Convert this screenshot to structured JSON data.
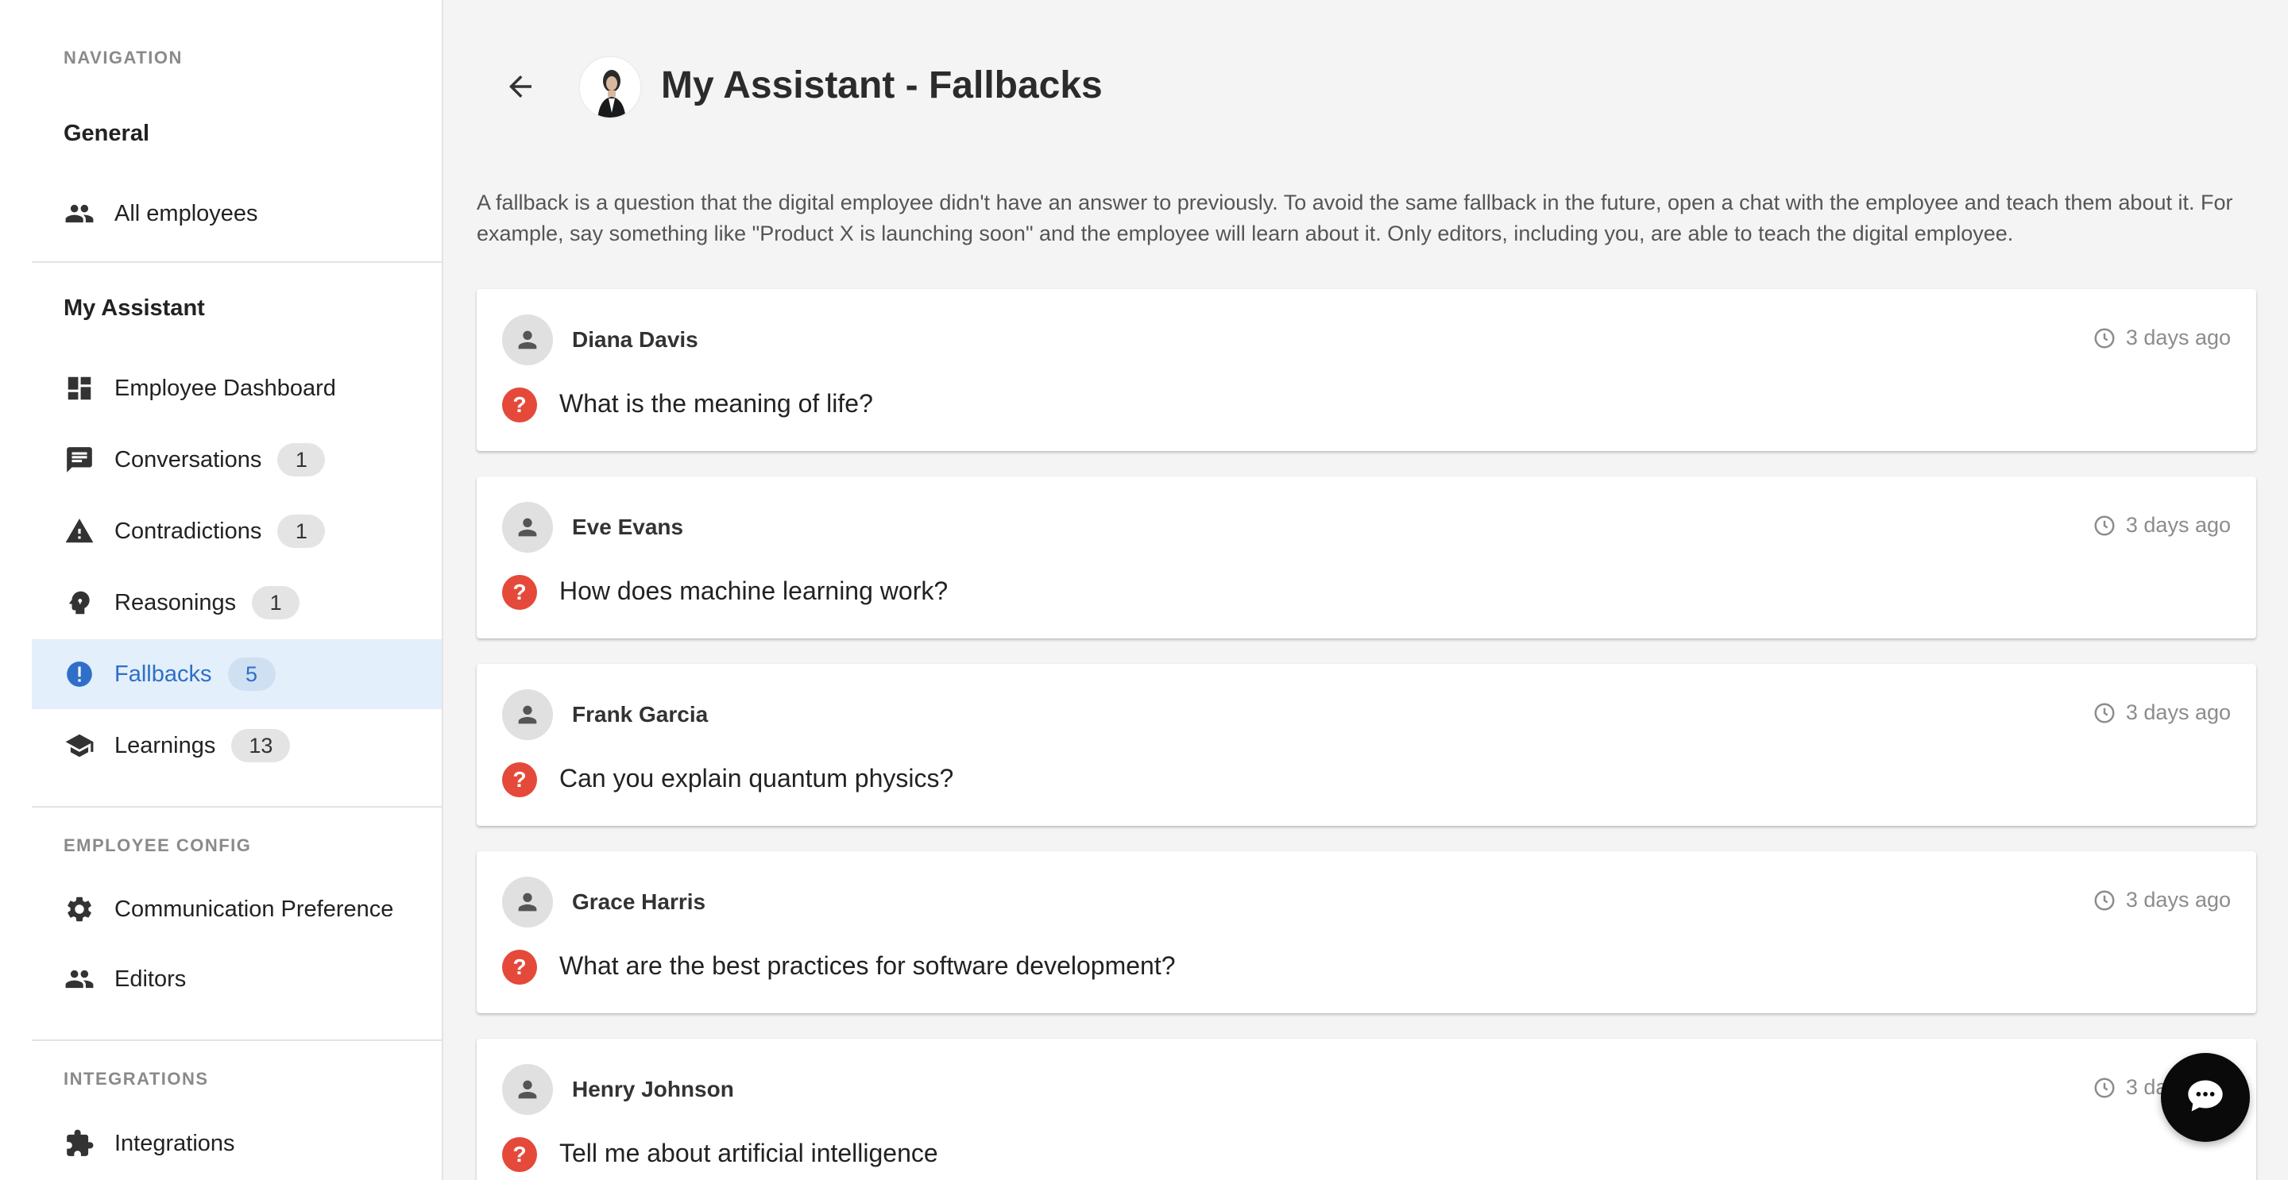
{
  "sidebar": {
    "navigation_heading": "NAVIGATION",
    "general": {
      "title": "General",
      "items": [
        {
          "label": "All employees",
          "icon": "people-icon"
        }
      ]
    },
    "assistant": {
      "title": "My Assistant",
      "items": [
        {
          "label": "Employee Dashboard",
          "icon": "dashboard-icon",
          "badge": ""
        },
        {
          "label": "Conversations",
          "icon": "chat-icon",
          "badge": "1"
        },
        {
          "label": "Contradictions",
          "icon": "warning-icon",
          "badge": "1"
        },
        {
          "label": "Reasonings",
          "icon": "brain-icon",
          "badge": "1"
        },
        {
          "label": "Fallbacks",
          "icon": "alert-circle-icon",
          "badge": "5",
          "active": true
        },
        {
          "label": "Learnings",
          "icon": "graduation-cap-icon",
          "badge": "13"
        }
      ]
    },
    "employee_config": {
      "heading": "EMPLOYEE CONFIG",
      "items": [
        {
          "label": "Communication Preference",
          "icon": "gear-icon"
        },
        {
          "label": "Editors",
          "icon": "people-icon"
        }
      ]
    },
    "integrations": {
      "heading": "INTEGRATIONS",
      "items": [
        {
          "label": "Integrations",
          "icon": "puzzle-icon"
        }
      ]
    }
  },
  "header": {
    "title": "My Assistant - Fallbacks",
    "back_icon": "arrow-left-icon"
  },
  "description": "A fallback is a question that the digital employee didn't have an answer to previously. To avoid the same fallback in the future, open a chat with the employee and teach them about it. For example, say something like \"Product X is launching soon\" and the employee will learn about it. Only editors, including you, are able to teach the digital employee.",
  "fallbacks": [
    {
      "name": "Diana Davis",
      "time": "3 days ago",
      "question": "What is the meaning of life?"
    },
    {
      "name": "Eve Evans",
      "time": "3 days ago",
      "question": "How does machine learning work?"
    },
    {
      "name": "Frank Garcia",
      "time": "3 days ago",
      "question": "Can you explain quantum physics?"
    },
    {
      "name": "Grace Harris",
      "time": "3 days ago",
      "question": "What are the best practices for software development?"
    },
    {
      "name": "Henry Johnson",
      "time": "3 days ago",
      "question": "Tell me about artificial intelligence"
    }
  ],
  "colors": {
    "active_bg": "#e3effa",
    "active_text": "#2f6fc9",
    "question_icon": "#e5493a",
    "fab": "#0a0a0a"
  }
}
